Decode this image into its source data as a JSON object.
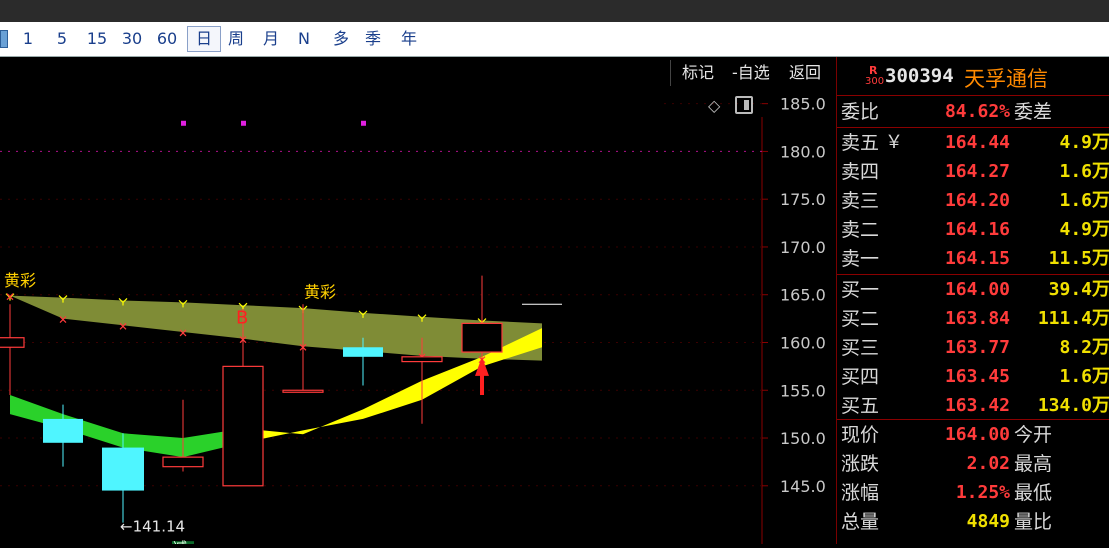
{
  "periods": [
    "1",
    "5",
    "15",
    "30",
    "60",
    "日",
    "周",
    "月",
    "N",
    "多",
    "季",
    "年"
  ],
  "active_period": "日",
  "header_buttons": {
    "mark": "标记",
    "watchlist": "-自选",
    "back": "返回"
  },
  "stock": {
    "code": "300394",
    "name": "天孚通信",
    "badge_top": "R",
    "badge_bottom": "300"
  },
  "yaxis": [
    "185.0",
    "180.0",
    "175.0",
    "170.0",
    "165.0",
    "160.0",
    "155.0",
    "150.0",
    "145.0"
  ],
  "chart_labels": {
    "huangcai_1": "黄彩",
    "huangcai_2": "黄彩",
    "buy_marker": "B",
    "low_marker": "←141.14",
    "reduce_marker": "减"
  },
  "chart_data": {
    "type": "candlestick",
    "ylim": [
      141,
      188
    ],
    "yticks": [
      185,
      180,
      175,
      170,
      165,
      160,
      155,
      150,
      145
    ],
    "candles": [
      {
        "o": 159.5,
        "h": 164.0,
        "l": 154.5,
        "c": 160.5,
        "color": "red"
      },
      {
        "o": 152.0,
        "h": 153.5,
        "l": 147.0,
        "c": 149.5,
        "color": "cyan"
      },
      {
        "o": 149.0,
        "h": 150.5,
        "l": 141.14,
        "c": 144.5,
        "color": "cyan"
      },
      {
        "o": 147.0,
        "h": 154.0,
        "l": 146.5,
        "c": 148.0,
        "color": "red"
      },
      {
        "o": 145.0,
        "h": 163.5,
        "l": 145.0,
        "c": 157.5,
        "color": "red"
      },
      {
        "o": 155.0,
        "h": 164.0,
        "l": 155.0,
        "c": 155.0,
        "color": "red"
      },
      {
        "o": 159.5,
        "h": 160.5,
        "l": 155.5,
        "c": 158.5,
        "color": "cyan"
      },
      {
        "o": 158.0,
        "h": 160.5,
        "l": 151.5,
        "c": 158.5,
        "color": "red"
      },
      {
        "o": 159.0,
        "h": 167.0,
        "l": 157.5,
        "c": 162.0,
        "color": "red"
      },
      {
        "o": 164.0,
        "h": 164.0,
        "l": 164.0,
        "c": 164.0,
        "color": "white"
      }
    ],
    "band_upper": [
      164.9,
      164.7,
      164.4,
      164.2,
      163.9,
      163.6,
      163.1,
      162.7,
      162.3,
      162.0
    ],
    "band_lower": [
      164.9,
      162.5,
      161.8,
      161.1,
      160.4,
      159.6,
      159.1,
      158.6,
      158.3,
      158.1
    ],
    "lower_band_a": [
      154.5,
      152.5,
      150.5,
      150.0,
      151.0,
      150.4,
      153.0,
      156.0,
      158.5,
      161.5
    ],
    "lower_band_b": [
      152.5,
      151.0,
      149.0,
      148.0,
      149.5,
      150.8,
      152.0,
      154.0,
      157.5,
      159.5
    ],
    "dotted_level": 180.0,
    "magenta_dots": [
      183.0,
      183.0,
      183.0
    ],
    "colors": {
      "up": "#ff3b3b",
      "down": "#4ff5ff",
      "band_fill": "#7f8c36",
      "yellow": "#ffff00",
      "green": "#2ad12a",
      "accent": "#ff8a00"
    }
  },
  "quote": {
    "weibi": {
      "label": "委比",
      "value": "84.62%",
      "label2": "委差"
    },
    "asks": [
      {
        "label": "卖五",
        "mark": "￥",
        "price": "164.44",
        "vol": "4.9万"
      },
      {
        "label": "卖四",
        "mark": "",
        "price": "164.27",
        "vol": "1.6万"
      },
      {
        "label": "卖三",
        "mark": "",
        "price": "164.20",
        "vol": "1.6万"
      },
      {
        "label": "卖二",
        "mark": "",
        "price": "164.16",
        "vol": "4.9万"
      },
      {
        "label": "卖一",
        "mark": "",
        "price": "164.15",
        "vol": "11.5万"
      }
    ],
    "bids": [
      {
        "label": "买一",
        "price": "164.00",
        "vol": "39.4万"
      },
      {
        "label": "买二",
        "price": "163.84",
        "vol": "111.4万"
      },
      {
        "label": "买三",
        "price": "163.77",
        "vol": "8.2万"
      },
      {
        "label": "买四",
        "price": "163.45",
        "vol": "1.6万"
      },
      {
        "label": "买五",
        "price": "163.42",
        "vol": "134.0万"
      }
    ],
    "stats": [
      {
        "label": "现价",
        "value": "164.00",
        "label2": "今开",
        "color": "red"
      },
      {
        "label": "涨跌",
        "value": "2.02",
        "label2": "最高",
        "color": "red"
      },
      {
        "label": "涨幅",
        "value": "1.25%",
        "label2": "最低",
        "color": "red"
      },
      {
        "label": "总量",
        "value": "4849",
        "label2": "量比",
        "color": "yellow"
      }
    ]
  }
}
